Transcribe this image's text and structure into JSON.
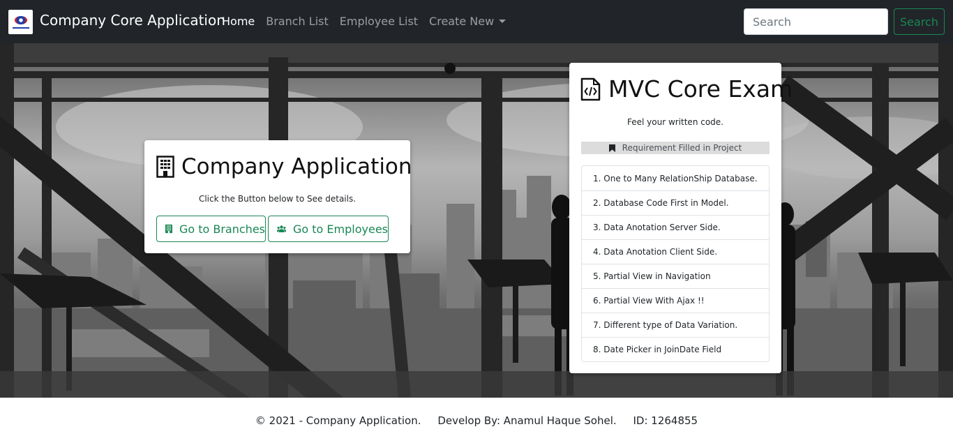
{
  "navbar": {
    "brand": "Company Core Application",
    "links": [
      {
        "label": "Home",
        "active": true
      },
      {
        "label": "Branch List",
        "active": false
      },
      {
        "label": "Employee List",
        "active": false
      },
      {
        "label": "Create New",
        "active": false
      }
    ],
    "search_placeholder": "Search",
    "search_button": "Search"
  },
  "company_card": {
    "icon": "building-icon",
    "title": "Company Application",
    "subtitle": "Click the Button below to See details.",
    "branches_button": "Go to Branches",
    "branches_icon": "building-icon",
    "employees_button": "Go to Employees",
    "employees_icon": "users-icon"
  },
  "exam_card": {
    "icon": "code-file-icon",
    "title": "MVC Core Exam",
    "subtitle": "Feel your written code.",
    "requirement_header": "Requirement Filled in Project",
    "requirement_icon": "bookmark-icon",
    "items": [
      "1. One to Many RelationShip Database.",
      "2. Database Code First in Model.",
      "3. Data Anotation Server Side.",
      "4. Data Anotation Client Side.",
      "5. Partial View in Navigation",
      "6. Partial View With Ajax !!",
      "7. Different type of Data Variation.",
      "8. Date Picker in JoinDate Field"
    ]
  },
  "footer": {
    "text": "© 2021 - Company Application.     Develop By: Anamul Haque Sohel.     ID: 1264855"
  },
  "colors": {
    "navbar_bg": "#212529",
    "accent_green": "#198754"
  }
}
